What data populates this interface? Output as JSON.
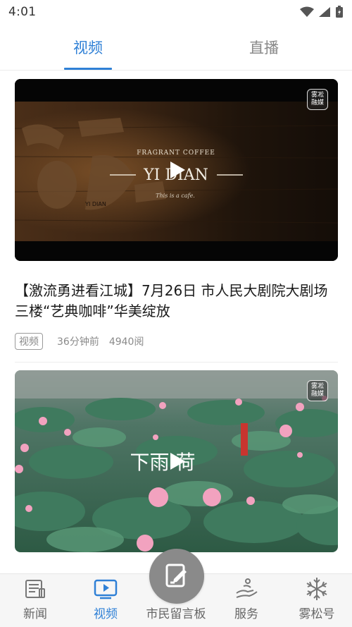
{
  "status_bar": {
    "time": "4:01"
  },
  "top_tabs": [
    {
      "label": "视频",
      "active": true
    },
    {
      "label": "直播",
      "active": false
    }
  ],
  "feed": [
    {
      "title": "【激流勇进看江城】7月26日 市人民大剧院大剧场三楼“艺典咖啡”华美绽放",
      "tag": "视频",
      "time_ago": "36分钟前",
      "reads": "4940阅",
      "badge": [
        "雾凇",
        "融媒"
      ],
      "thumb_text": {
        "brand": "FRAGRANT COFFEE",
        "logo": "YI DIAN",
        "sub": "This is a cafe.",
        "left": "YI DIAN"
      }
    },
    {
      "badge": [
        "雾凇",
        "融媒"
      ],
      "thumb_text": {
        "title": "下雨·荷"
      }
    }
  ],
  "bottom_nav": [
    {
      "label": "新闻",
      "icon": "news-icon",
      "active": false
    },
    {
      "label": "视频",
      "icon": "video-icon",
      "active": true
    },
    {
      "label": "市民留言板",
      "icon": "message-board-icon",
      "active": false
    },
    {
      "label": "服务",
      "icon": "service-icon",
      "active": false
    },
    {
      "label": "雾松号",
      "icon": "snowflake-icon",
      "active": false
    }
  ],
  "colors": {
    "accent": "#2f80d6",
    "muted": "#888888",
    "nav_bg": "#f6f6f6"
  }
}
